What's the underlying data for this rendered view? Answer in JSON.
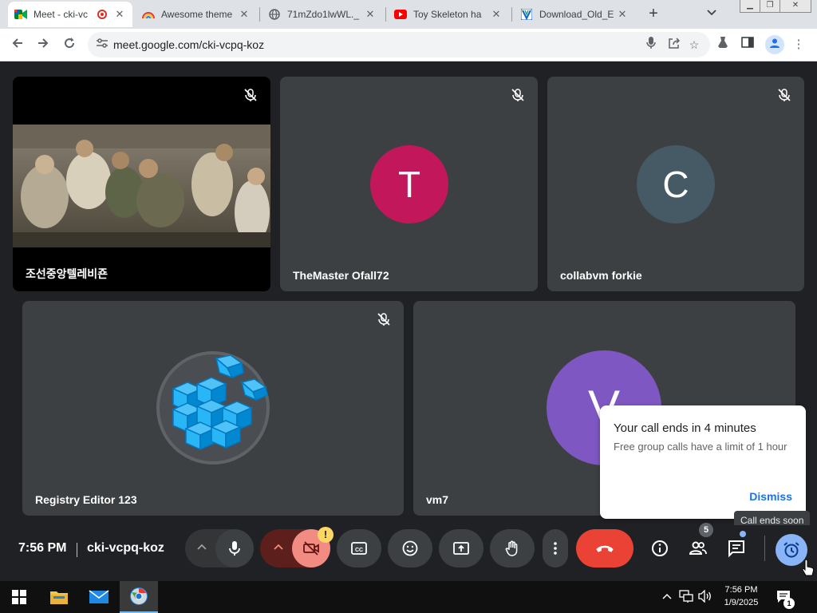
{
  "browser": {
    "tabs": [
      {
        "title": "Meet - cki-vc",
        "favicon": "google-meet-icon",
        "active": true,
        "recording": true
      },
      {
        "title": "Awesome theme",
        "favicon": "rainbow-icon"
      },
      {
        "title": "71mZdo1lwWL._",
        "favicon": "globe-icon"
      },
      {
        "title": "Toy Skeleton ha",
        "favicon": "youtube-icon"
      },
      {
        "title": "Download_Old_E",
        "favicon": "v-logo-icon"
      }
    ],
    "url": "meet.google.com/cki-vcpq-koz"
  },
  "meeting": {
    "time": "7:56 PM",
    "code": "cki-vcpq-koz",
    "participant_count": "5",
    "warning_mark": "!",
    "participants": [
      {
        "name": "조선중앙텔레비죤",
        "type": "video"
      },
      {
        "name": "TheMaster Ofall72",
        "initial": "T",
        "color": "#c2185b"
      },
      {
        "name": "collabvm forkie",
        "initial": "C",
        "color": "#455a64"
      },
      {
        "name": "Registry Editor 123",
        "type": "image"
      },
      {
        "name": "vm7",
        "initial": "V",
        "color": "#7e57c2"
      }
    ]
  },
  "notification": {
    "title": "Your call ends in 4 minutes",
    "body": "Free group calls have a limit of 1 hour",
    "dismiss": "Dismiss"
  },
  "tooltip": "Call ends soon",
  "taskbar": {
    "time": "7:56 PM",
    "date": "1/9/2025",
    "notification_count": "1"
  },
  "colors": {
    "end_call": "#ea4335",
    "camera_off": "#f28b82",
    "accent": "#1a73e8",
    "timer_button": "#8ab4f8"
  }
}
